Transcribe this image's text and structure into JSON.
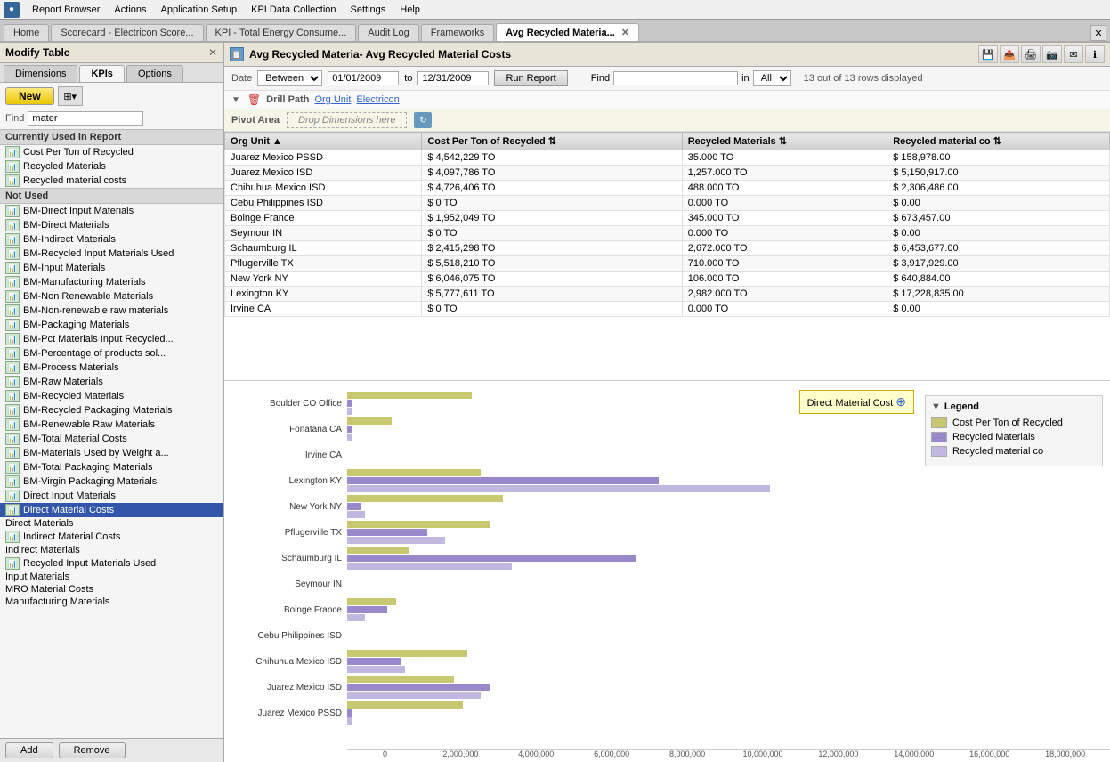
{
  "menu": {
    "items": [
      "Report Browser",
      "Actions",
      "Application Setup",
      "KPI Data Collection",
      "Settings",
      "Help"
    ]
  },
  "tabs": [
    {
      "label": "Home",
      "active": false
    },
    {
      "label": "Scorecard - Electricon Score...",
      "active": false
    },
    {
      "label": "KPI - Total Energy Consume...",
      "active": false
    },
    {
      "label": "Audit Log",
      "active": false
    },
    {
      "label": "Frameworks",
      "active": false
    },
    {
      "label": "Avg Recycled Materia...",
      "active": true,
      "closeable": true
    }
  ],
  "left_panel": {
    "title": "Modify Table",
    "tabs": [
      "Dimensions",
      "KPIs",
      "Options"
    ],
    "active_tab": "KPIs",
    "new_button": "New",
    "find_label": "Find",
    "find_value": "mater",
    "currently_used_header": "Currently Used in Report",
    "currently_used": [
      {
        "text": "Cost Per Ton of Recycled",
        "has_icon": true
      },
      {
        "text": "Recycled Materials",
        "has_icon": true
      },
      {
        "text": "Recycled material costs",
        "has_icon": true
      }
    ],
    "not_used_header": "Not Used",
    "not_used": [
      {
        "text": "BM-Direct Input Materials",
        "has_icon": true
      },
      {
        "text": "BM-Direct Materials",
        "has_icon": true
      },
      {
        "text": "BM-Indirect Materials",
        "has_icon": true
      },
      {
        "text": "BM-Recycled Input Materials Used",
        "has_icon": true
      },
      {
        "text": "BM-Input Materials",
        "has_icon": true
      },
      {
        "text": "BM-Manufacturing Materials",
        "has_icon": true
      },
      {
        "text": "BM-Non Renewable Materials",
        "has_icon": true
      },
      {
        "text": "BM-Non-renewable raw materials",
        "has_icon": true
      },
      {
        "text": "BM-Packaging Materials",
        "has_icon": true
      },
      {
        "text": "BM-Pct Materials Input Recycled...",
        "has_icon": true
      },
      {
        "text": "BM-Percentage of products sol...",
        "has_icon": true
      },
      {
        "text": "BM-Process Materials",
        "has_icon": true
      },
      {
        "text": "BM-Raw Materials",
        "has_icon": true
      },
      {
        "text": "BM-Recycled Materials",
        "has_icon": true
      },
      {
        "text": "BM-Recycled Packaging Materials",
        "has_icon": true
      },
      {
        "text": "BM-Renewable Raw Materials",
        "has_icon": true
      },
      {
        "text": "BM-Total Material Costs",
        "has_icon": true
      },
      {
        "text": "BM-Materials Used by Weight a...",
        "has_icon": true
      },
      {
        "text": "BM-Total Packaging Materials",
        "has_icon": true
      },
      {
        "text": "BM-Virgin Packaging Materials",
        "has_icon": true
      },
      {
        "text": "Direct Input Materials",
        "has_icon": true
      },
      {
        "text": "Direct Material Costs",
        "has_icon": true,
        "highlighted": true
      },
      {
        "text": "Direct Materials",
        "has_icon": false
      },
      {
        "text": "Indirect Material Costs",
        "has_icon": true
      },
      {
        "text": "Indirect Materials",
        "has_icon": false
      },
      {
        "text": "Recycled Input Materials Used",
        "has_icon": true
      },
      {
        "text": "Input Materials",
        "has_icon": false
      },
      {
        "text": "MRO Material Costs",
        "has_icon": false
      },
      {
        "text": "Manufacturing Materials",
        "has_icon": false
      }
    ],
    "add_button": "Add",
    "remove_button": "Remove"
  },
  "report": {
    "title": "Avg Recycled Materia- Avg Recycled Material Costs",
    "date_label": "Date",
    "date_between": "Between",
    "date_from": "01/01/2009",
    "date_to": "12/31/2009",
    "run_button": "Run Report",
    "find_label": "Find",
    "find_in_label": "in",
    "find_in_value": "All",
    "rows_info": "13 out of 13 rows displayed",
    "drill_path_label": "Drill Path",
    "drill_path_items": [
      "Org Unit",
      "Electricon"
    ],
    "pivot_label": "Pivot Area",
    "drop_label": "Drop Dimensions here",
    "table": {
      "columns": [
        "Org Unit",
        "Cost Per Ton of Recycled",
        "Recycled Materials",
        "Recycled material co"
      ],
      "rows": [
        [
          "Juarez Mexico PSSD",
          "$ 4,542,229 TO",
          "35.000 TO",
          "$ 158,978.00"
        ],
        [
          "Juarez Mexico ISD",
          "$ 4,097,786 TO",
          "1,257.000 TO",
          "$ 5,150,917.00"
        ],
        [
          "Chihuhua Mexico ISD",
          "$ 4,726,406 TO",
          "488.000 TO",
          "$ 2,306,486.00"
        ],
        [
          "Cebu Philippines ISD",
          "$ 0 TO",
          "0.000 TO",
          "$ 0.00"
        ],
        [
          "Boinge France",
          "$ 1,952,049 TO",
          "345.000 TO",
          "$ 673,457.00"
        ],
        [
          "Seymour IN",
          "$ 0 TO",
          "0.000 TO",
          "$ 0.00"
        ],
        [
          "Schaumburg IL",
          "$ 2,415,298 TO",
          "2,672.000 TO",
          "$ 6,453,677.00"
        ],
        [
          "Pflugerville TX",
          "$ 5,518,210 TO",
          "710.000 TO",
          "$ 3,917,929.00"
        ],
        [
          "New York NY",
          "$ 6,046,075 TO",
          "106.000 TO",
          "$ 640,884.00"
        ],
        [
          "Lexington KY",
          "$ 5,777,611 TO",
          "2,982.000 TO",
          "$ 17,228,835.00"
        ],
        [
          "Irvine CA",
          "$ 0 TO",
          "0.000 TO",
          "$ 0.00"
        ]
      ]
    },
    "chart": {
      "rows": [
        {
          "label": "Boulder CO Office",
          "bar1": 0.28,
          "bar2": 0.01,
          "bar3": 0.01
        },
        {
          "label": "Fonatana CA",
          "bar1": 0.1,
          "bar2": 0.01,
          "bar3": 0.01
        },
        {
          "label": "Irvine CA",
          "bar1": 0.0,
          "bar2": 0.0,
          "bar3": 0.0
        },
        {
          "label": "Lexington KY",
          "bar1": 0.3,
          "bar2": 0.7,
          "bar3": 0.95
        },
        {
          "label": "New York NY",
          "bar1": 0.35,
          "bar2": 0.03,
          "bar3": 0.04
        },
        {
          "label": "Pflugerville TX",
          "bar1": 0.32,
          "bar2": 0.18,
          "bar3": 0.22
        },
        {
          "label": "Schaumburg IL",
          "bar1": 0.14,
          "bar2": 0.65,
          "bar3": 0.37
        },
        {
          "label": "Seymour IN",
          "bar1": 0.0,
          "bar2": 0.0,
          "bar3": 0.0
        },
        {
          "label": "Boinge France",
          "bar1": 0.11,
          "bar2": 0.09,
          "bar3": 0.04
        },
        {
          "label": "Cebu Philippines ISD",
          "bar1": 0.0,
          "bar2": 0.0,
          "bar3": 0.0
        },
        {
          "label": "Chihuhua Mexico ISD",
          "bar1": 0.27,
          "bar2": 0.12,
          "bar3": 0.13
        },
        {
          "label": "Juarez Mexico ISD",
          "bar1": 0.24,
          "bar2": 0.32,
          "bar3": 0.3
        },
        {
          "label": "Juarez Mexico PSSD",
          "bar1": 0.26,
          "bar2": 0.01,
          "bar3": 0.01
        }
      ],
      "x_labels": [
        "0",
        "2,000,000",
        "4,000,000",
        "6,000,000",
        "8,000,000",
        "10,000,000",
        "12,000,000",
        "14,000,000",
        "16,000,000",
        "18,000,000"
      ]
    },
    "legend": {
      "title": "Legend",
      "items": [
        {
          "label": "Cost Per Ton of Recycled",
          "color": "#c8c870"
        },
        {
          "label": "Recycled Materials",
          "color": "#9988cc"
        },
        {
          "label": "Recycled material co",
          "color": "#c0b8e0"
        }
      ]
    },
    "tooltip": "Direct Material Cost"
  }
}
